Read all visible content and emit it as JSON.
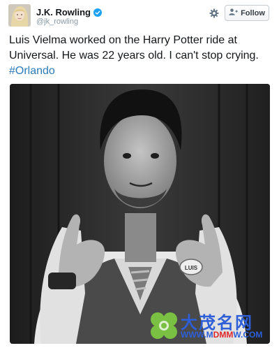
{
  "user": {
    "display_name": "J.K. Rowling",
    "handle": "@jk_rowling",
    "verified": true
  },
  "actions": {
    "follow_label": "Follow"
  },
  "tweet": {
    "text_main": "Luis Vielma worked on the Harry Potter ride at Universal. He was 22 years old. I can't stop crying. ",
    "hashtag": "#Orlando"
  },
  "photo": {
    "badge_text": "LUIS"
  },
  "watermark": {
    "chinese": "大茂名网",
    "url_prefix": "WWW.M",
    "url_middle": "DMM",
    "url_suffix": "W.COM"
  },
  "colors": {
    "link": "#2b7bb9",
    "verified": "#1da1f2",
    "watermark_blue": "#2e5fd6",
    "watermark_red": "#e0262b"
  }
}
